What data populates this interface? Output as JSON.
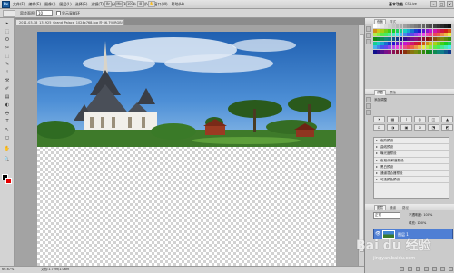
{
  "app": {
    "logo": "Ps",
    "workspace": "基本功能",
    "cs_live": "CS Live"
  },
  "menu": [
    "文件(F)",
    "编辑(E)",
    "图像(I)",
    "图层(L)",
    "选择(S)",
    "滤镜(T)",
    "分析(A)",
    "3D(D)",
    "视图(V)",
    "窗口(W)",
    "帮助(H)"
  ],
  "menu_tools": [
    "Br",
    "Mb",
    "100%",
    "⊞",
    "✋"
  ],
  "window_controls": [
    "–",
    "□",
    "×"
  ],
  "options_bar": {
    "label": "容差面积:",
    "select_value": "10",
    "checkbox_label": "显示采样环"
  },
  "document_tab": "2011-03-18_131925_Grand_Palace_1024x768.jpg @ 66.7%(RGB/8)",
  "toolbar": {
    "tools": [
      "▸",
      "⬚",
      "ʘ",
      "✂",
      "⬚",
      "✎",
      "⟟",
      "⚒",
      "✐",
      "▤",
      "◐",
      "◓",
      "T",
      "↖",
      "◻",
      "✋",
      "🔍"
    ]
  },
  "colors": {
    "foreground": "#000000",
    "background": "#e30000",
    "accent": "#4f7fd4"
  },
  "status": {
    "zoom": "66.67%",
    "doc_info": "文档:1.72M/1.06M"
  },
  "panels": {
    "swatches_tab": "色板",
    "styles_tab": "样式",
    "adjustments_tab": "调整",
    "masks_tab": "蒙版",
    "adjust_add_label": "添加调整",
    "adjust_icons": [
      "☀",
      "▦",
      "⌇",
      "◐",
      "◫",
      "▲",
      "⚖",
      "◑",
      "▣",
      "⊘",
      "⬔",
      "◩"
    ],
    "presets": [
      "色阶预设",
      "曲线预设",
      "曝光度预设",
      "色相/饱和度预设",
      "黑白预设",
      "通道混合器预设",
      "可选颜色预设"
    ],
    "layers_tab": "图层",
    "channels_tab": "通道",
    "paths_tab": "路径",
    "blend_mode": "正常",
    "opacity_label": "不透明度:",
    "opacity_value": "100%",
    "fill_label": "填充:",
    "fill_value": "100%",
    "layer_name": "图层 1"
  },
  "watermark": {
    "text": "Bai du 经验",
    "sub": "jingyan.baidu.com"
  }
}
